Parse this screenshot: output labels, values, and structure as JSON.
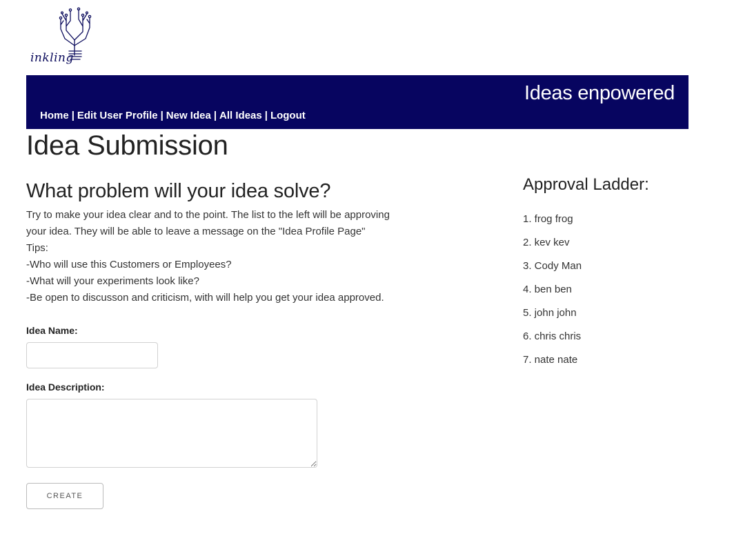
{
  "logo": {
    "icon": "tree-lightbulb-icon",
    "wordmark": "inkling"
  },
  "header": {
    "tagline": "Ideas enpowered",
    "nav": [
      {
        "label": "Home"
      },
      {
        "label": "Edit User Profile"
      },
      {
        "label": "New Idea"
      },
      {
        "label": "All Ideas"
      },
      {
        "label": "Logout"
      }
    ],
    "separator": "|"
  },
  "page": {
    "title": "Idea Submission"
  },
  "form": {
    "heading": "What problem will your idea solve?",
    "instructions": [
      "Try to make your idea clear and to the point. The list to the left will be approving your idea. They will be able to leave a message on the \"Idea Profile Page\"",
      "Tips:",
      "-Who will use this Customers or Employees?",
      "-What will your experiments look like?",
      "-Be open to discusson and criticism, with will help you get your idea approved."
    ],
    "idea_name_label": "Idea Name:",
    "idea_name_value": "",
    "idea_description_label": "Idea Description:",
    "idea_description_value": "",
    "create_label": "CREATE"
  },
  "ladder": {
    "heading": "Approval Ladder:",
    "items": [
      "1. frog frog",
      "2. kev kev",
      "3. Cody Man",
      "4. ben ben",
      "5. john john",
      "6. chris chris",
      "7. nate nate"
    ]
  },
  "colors": {
    "header_bg": "#070560",
    "header_text": "#ffffff",
    "logo_ink": "#0b0b5c"
  }
}
